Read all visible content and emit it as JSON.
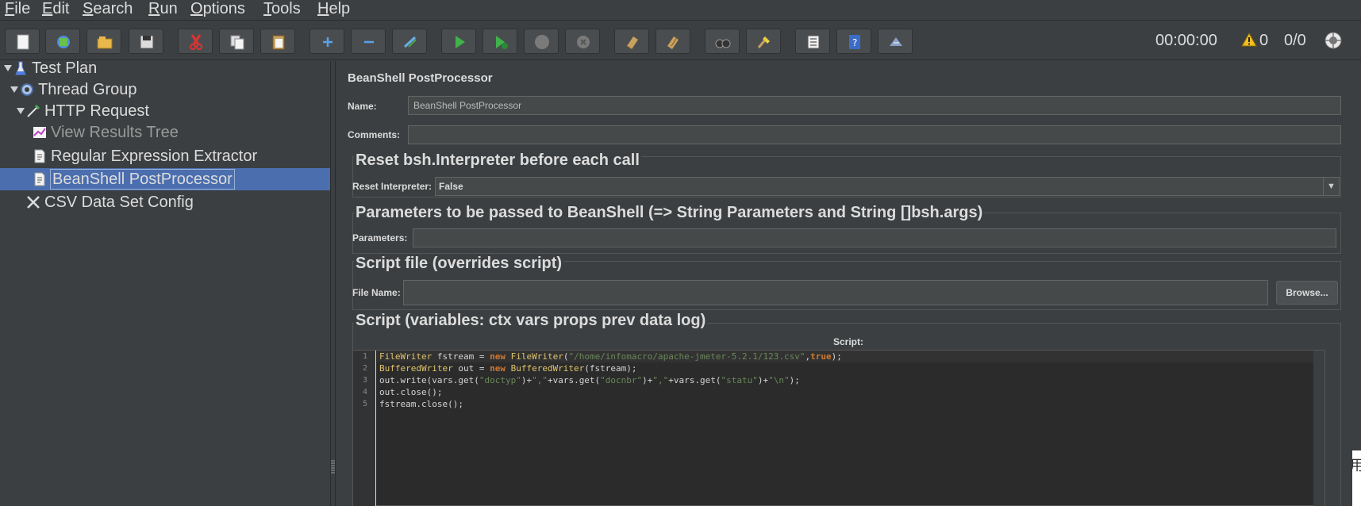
{
  "menu": [
    "File",
    "Edit",
    "Search",
    "Run",
    "Options",
    "Tools",
    "Help"
  ],
  "toolbar": {
    "timer": "00:00:00",
    "warnings": "0",
    "threads": "0/0",
    "buttons": [
      "new-icon",
      "templates-icon",
      "open-icon",
      "save-icon",
      "cut-icon",
      "copy-icon",
      "paste-icon",
      "expand-icon",
      "collapse-icon",
      "toggle-icon",
      "start-icon",
      "start-no-pause-icon",
      "stop-icon",
      "shutdown-icon",
      "clear-icon",
      "clear-all-icon",
      "search-icon",
      "reset-search-icon",
      "function-helper-icon",
      "help-icon",
      "remote-icon",
      "log-icon"
    ]
  },
  "tree": [
    {
      "label": "Test Plan"
    },
    {
      "label": "Thread Group"
    },
    {
      "label": "HTTP Request"
    },
    {
      "label": "View Results Tree"
    },
    {
      "label": "Regular Expression Extractor"
    },
    {
      "label": "BeanShell PostProcessor"
    },
    {
      "label": "CSV Data Set Config"
    }
  ],
  "panel": {
    "title": "BeanShell PostProcessor",
    "name_label": "Name:",
    "name_value": "BeanShell PostProcessor",
    "comments_label": "Comments:",
    "comments_value": "",
    "reset_group_title": "Reset bsh.Interpreter before each call",
    "reset_label": "Reset Interpreter:",
    "reset_value": "False",
    "params_group_title": "Parameters to be passed to BeanShell (=> String Parameters and String []bsh.args)",
    "params_label": "Parameters:",
    "params_value": "",
    "file_group_title": "Script file (overrides script)",
    "file_label": "File Name:",
    "file_value": "",
    "browse_label": "Browse...",
    "script_group_title": "Script (variables: ctx vars props prev data log)",
    "script_label": "Script:"
  },
  "script_lines": [
    "FileWriter fstream = new FileWriter(\"/home/infomacro/apache-jmeter-5.2.1/123.csv\",true);",
    "BufferedWriter out = new BufferedWriter(fstream);",
    "out.write(vars.get(\"doctyp\")+\",\"+vars.get(\"docnbr\")+\",\"+vars.get(\"statu\")+\"\\n\");",
    "out.close();",
    "fstream.close();"
  ],
  "edge_char": "用"
}
